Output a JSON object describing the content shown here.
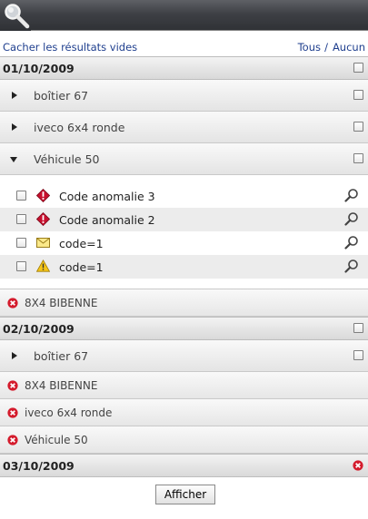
{
  "controls": {
    "hide_empty": "Cacher les résultats vides",
    "all": "Tous",
    "separator": "/",
    "none": "Aucun"
  },
  "dates": [
    {
      "date": "01/10/2009",
      "groups": [
        "boîtier 67",
        "iveco 6x4 ronde",
        "Véhicule 50"
      ],
      "expanded_items": [
        {
          "label": "Code anomalie 3",
          "icon": "red-alert-icon"
        },
        {
          "label": "Code anomalie 2",
          "icon": "red-alert-icon"
        },
        {
          "label": "code=1",
          "icon": "envelope-icon"
        },
        {
          "label": "code=1",
          "icon": "warning-icon"
        }
      ],
      "errors": [
        "8X4 BIBENNE"
      ]
    },
    {
      "date": "02/10/2009",
      "groups": [
        "boîtier 67"
      ],
      "errors": [
        "8X4 BIBENNE",
        "iveco 6x4 ronde",
        "Véhicule 50"
      ]
    },
    {
      "date": "03/10/2009"
    }
  ],
  "footer": {
    "button": "Afficher"
  },
  "colors": {
    "link": "#1f3f8e",
    "error": "#c8102e",
    "header": "#3e4045"
  }
}
